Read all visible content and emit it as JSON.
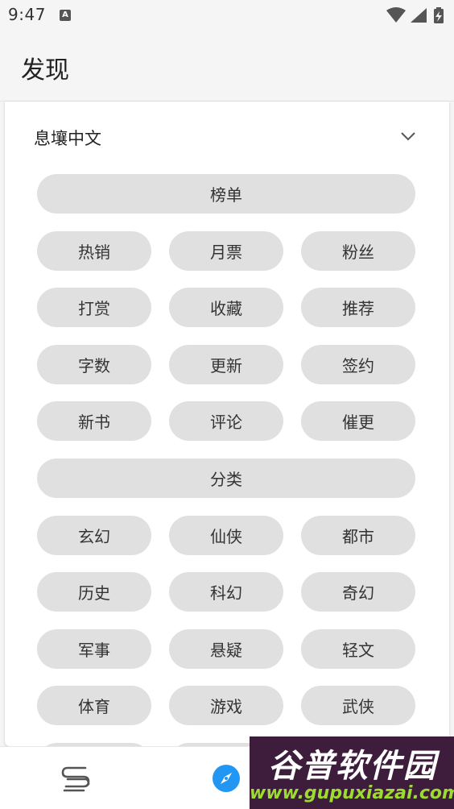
{
  "status_bar": {
    "time": "9:47",
    "notification_glyph": "A"
  },
  "app_bar": {
    "title": "发现"
  },
  "source": {
    "name": "息壤中文"
  },
  "sections": {
    "rank": {
      "header": "榜单",
      "items": [
        "热销",
        "月票",
        "粉丝",
        "打赏",
        "收藏",
        "推荐",
        "字数",
        "更新",
        "签约",
        "新书",
        "评论",
        "催更"
      ]
    },
    "category": {
      "header": "分类",
      "items": [
        "玄幻",
        "仙侠",
        "都市",
        "历史",
        "科幻",
        "奇幻",
        "军事",
        "悬疑",
        "轻文",
        "体育",
        "游戏",
        "武侠"
      ]
    }
  },
  "watermark": {
    "title": "谷普软件园",
    "url": "www.gupuxiazai.com"
  }
}
